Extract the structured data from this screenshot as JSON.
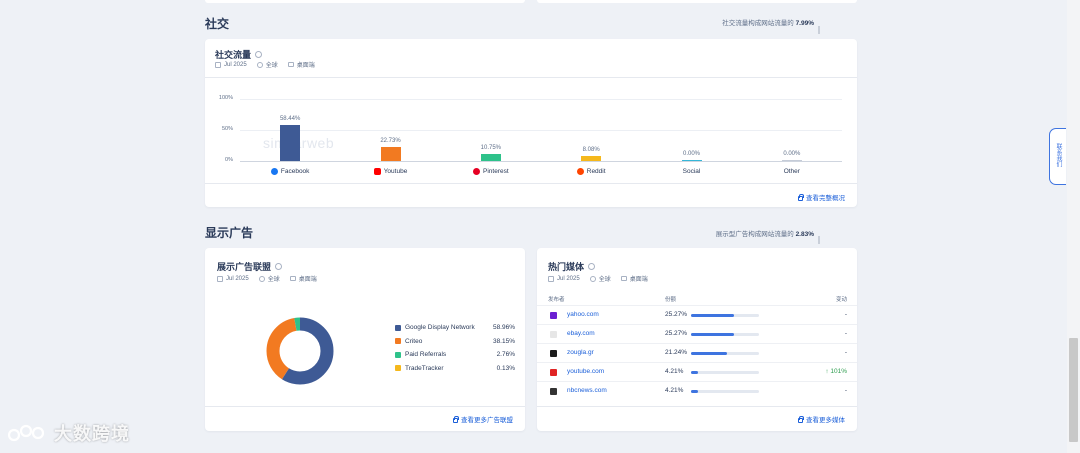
{
  "social_section": {
    "title": "社交",
    "note_text": "社交流量构成网站流量的",
    "note_value": "7.99%",
    "card": {
      "title": "社交流量",
      "meta": {
        "date": "Jul 2025",
        "region": "全球",
        "device": "桌面端"
      },
      "footer_link": "查看完整概况"
    }
  },
  "chart_data": {
    "type": "bar",
    "categories": [
      "Facebook",
      "Youtube",
      "Pinterest",
      "Reddit",
      "Social",
      "Other"
    ],
    "values": [
      58.44,
      22.73,
      10.75,
      8.08,
      0.0,
      0.0
    ],
    "value_labels": [
      "58.44%",
      "22.73%",
      "10.75%",
      "8.08%",
      "0.00%",
      "0.00%"
    ],
    "colors": [
      "#3e5a95",
      "#f27a21",
      "#2ec28a",
      "#f5b81c",
      "#36b7d8",
      "#c5ccd8"
    ],
    "ylim": [
      0,
      100
    ],
    "yticks": [
      "100%",
      "50%",
      "0%"
    ],
    "grid": true
  },
  "category_icons": [
    "facebook-icon",
    "youtube-icon",
    "pinterest-icon",
    "reddit-icon",
    "",
    ""
  ],
  "watermark_text": "similarweb",
  "display_section": {
    "title": "显示广告",
    "note_text": "展示型广告构成网站流量的",
    "note_value": "2.83%"
  },
  "ad_network_card": {
    "title": "展示广告联盟",
    "meta": {
      "date": "Jul 2025",
      "region": "全球",
      "device": "桌面端"
    },
    "legend": [
      {
        "name": "Google Display Network",
        "value": "58.96%",
        "share": 58.96,
        "color": "#3e5a95"
      },
      {
        "name": "Criteo",
        "value": "38.15%",
        "share": 38.15,
        "color": "#f27a21"
      },
      {
        "name": "Paid Referrals",
        "value": "2.76%",
        "share": 2.76,
        "color": "#2ec28a"
      },
      {
        "name": "TradeTracker",
        "value": "0.13%",
        "share": 0.13,
        "color": "#f5b81c"
      }
    ],
    "footer_link": "查看更多广告联盟"
  },
  "top_media_card": {
    "title": "热门媒体",
    "meta": {
      "date": "Jul 2025",
      "region": "全球",
      "device": "桌面端"
    },
    "headers": {
      "publisher": "发布者",
      "share": "份额",
      "change": "变动"
    },
    "rows": [
      {
        "site": "yahoo.com",
        "share": "25.27%",
        "share_value": 25.27,
        "change": "-",
        "fav_color": "#6a1fd1"
      },
      {
        "site": "ebay.com",
        "share": "25.27%",
        "share_value": 25.27,
        "change": "-",
        "fav_color": "#e6e6e6"
      },
      {
        "site": "zougla.gr",
        "share": "21.24%",
        "share_value": 21.24,
        "change": "-",
        "fav_color": "#1b1b1b"
      },
      {
        "site": "youtube.com",
        "share": "4.21%",
        "share_value": 4.21,
        "change": "↑ 101%",
        "fav_color": "#e02424"
      },
      {
        "site": "nbcnews.com",
        "share": "4.21%",
        "share_value": 4.21,
        "change": "-",
        "fav_color": "#333333"
      }
    ],
    "footer_link": "查看更多媒体"
  },
  "side_tab_label": "联系我们",
  "bottom_watermark": "大数跨境"
}
